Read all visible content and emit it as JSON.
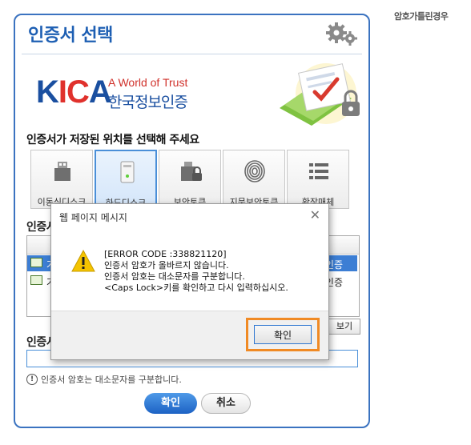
{
  "caption": "암호가틀린경우",
  "window": {
    "title": "인증서 선택",
    "logo": {
      "brand_k": "K",
      "brand_ic": "IC",
      "brand_a": "A",
      "slogan": "A World of Trust",
      "org": "한국정보인증"
    },
    "location_prompt": "인증서가 저장된 위치를 선택해 주세요",
    "devices": [
      {
        "label": "이동식디스크",
        "icon": "usb-drive-icon"
      },
      {
        "label": "하드디스크",
        "icon": "hard-disk-icon"
      },
      {
        "label": "보안토큰",
        "icon": "security-token-icon"
      },
      {
        "label": "지문보안토큰",
        "icon": "fingerprint-icon"
      },
      {
        "label": "확장매체",
        "icon": "extended-media-icon"
      }
    ],
    "cert_list_label": "인증서",
    "cert_rows": [
      {
        "name": "가",
        "usage": "인증"
      },
      {
        "name": "가",
        "usage": "인증"
      }
    ],
    "view_button": "보기",
    "password_label": "인증서",
    "notice": "인증서 암호는 대소문자를 구분합니다.",
    "ok_button": "확인",
    "cancel_button": "취소"
  },
  "dialog": {
    "title": "웹 페이지 메시지",
    "message": "[ERROR CODE :338821120]\n인증서 암호가 올바르지 않습니다.\n인증서 암호는 대소문자를 구분합니다.\n<Caps Lock>키를 확인하고 다시 입력하십시오.",
    "ok_button": "확인"
  }
}
